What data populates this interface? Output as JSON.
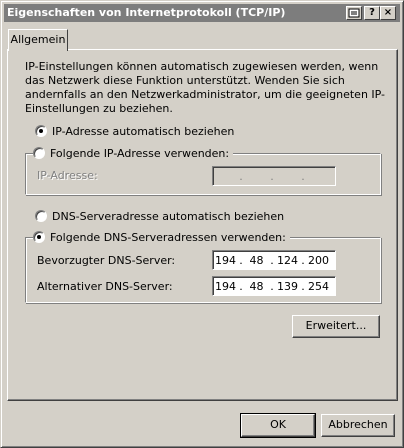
{
  "window": {
    "title": "Eigenschaften von Internetprotokoll (TCP/IP)",
    "buttons": {
      "properties_icon": "properties-icon",
      "help": "?",
      "close": "×"
    }
  },
  "tabs": [
    {
      "label": "Allgemein",
      "selected": true
    }
  ],
  "intro_text": "IP-Einstellungen können automatisch zugewiesen werden, wenn das Netzwerk diese Funktion unterstützt. Wenden Sie sich andernfalls an den Netzwerkadministrator, um die geeigneten IP-Einstellungen zu beziehen.",
  "ip": {
    "auto_label": "IP-Adresse automatisch beziehen",
    "auto_selected": true,
    "manual_label": "Folgende IP-Adresse verwenden:",
    "manual_selected": false,
    "address_label": "IP-Adresse:",
    "address_dots": [
      ".",
      ".",
      "."
    ]
  },
  "dns": {
    "auto_label": "DNS-Serveradresse automatisch beziehen",
    "auto_selected": false,
    "manual_label": "Folgende DNS-Serveradressen verwenden:",
    "manual_selected": true,
    "preferred_label": "Bevorzugter DNS-Server:",
    "preferred": [
      "194",
      "48",
      "124",
      "200"
    ],
    "alternate_label": "Alternativer DNS-Server:",
    "alternate": [
      "194",
      "48",
      "139",
      "254"
    ]
  },
  "buttons": {
    "advanced": "Erweitert...",
    "ok": "OK",
    "cancel": "Abbrechen"
  }
}
